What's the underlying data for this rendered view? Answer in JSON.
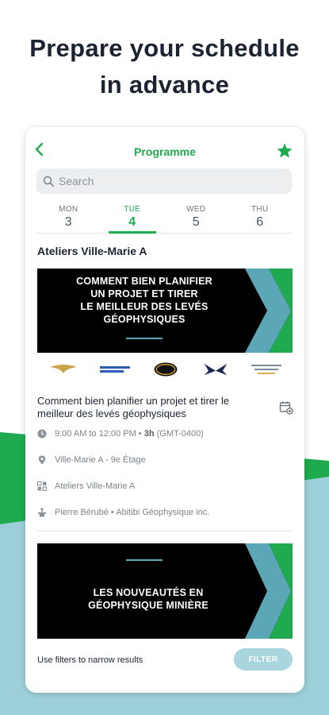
{
  "headline": {
    "line1": "Prepare your schedule",
    "line2": "in advance"
  },
  "app": {
    "title": "Programme",
    "search_placeholder": "Search",
    "accent": "#1faa4f"
  },
  "days": [
    {
      "name": "MON",
      "num": "3"
    },
    {
      "name": "TUE",
      "num": "4"
    },
    {
      "name": "WED",
      "num": "5"
    },
    {
      "name": "THU",
      "num": "6"
    }
  ],
  "section_title": "Ateliers Ville-Marie A",
  "banner1": {
    "line1": "COMMENT BIEN PLANIFIER",
    "line2": "UN PROJET ET TIRER",
    "line3": "LE MEILLEUR DES LEVÉS",
    "line4": "GÉOPHYSIQUES"
  },
  "event": {
    "title": "Comment bien planifier un projet et tirer le meilleur des levés géophysiques",
    "time": "9:00 AM to 12:00 PM",
    "duration": "3h",
    "timezone": "(GMT-0400)",
    "location": "Ville-Marie A - 9e Étage",
    "track": "Ateliers Ville-Marie A",
    "speaker": "Pierre Bérubé • Abitibi Géophysique inc."
  },
  "banner2": {
    "line1": "LES NOUVEAUTÉS EN",
    "line2": "GÉOPHYSIQUE MINIÈRE"
  },
  "filter": {
    "hint": "Use filters to narrow results",
    "button": "FILTER"
  }
}
